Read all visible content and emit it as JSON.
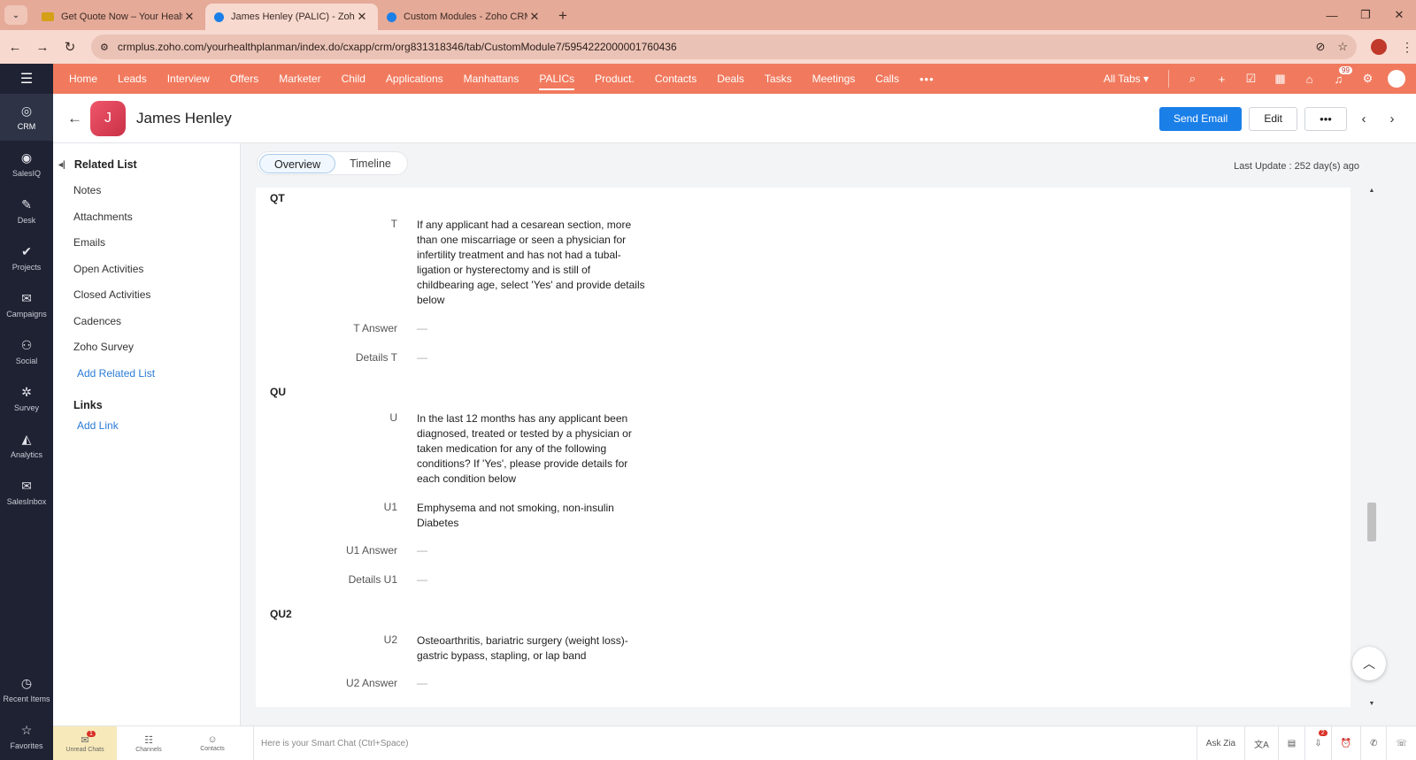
{
  "browser": {
    "tabs": [
      {
        "title": "Get Quote Now – Your Health P",
        "active": false,
        "favicon_color": "#d4a017"
      },
      {
        "title": "James Henley (PALIC) - Zoho CR",
        "active": true,
        "favicon_color": "#1b7fe8"
      },
      {
        "title": "Custom Modules - Zoho CRM",
        "active": false,
        "favicon_color": "#1b7fe8"
      }
    ],
    "new_tab": "+",
    "url": "crmplus.zoho.com/yourhealthplanman/index.do/cxapp/crm/org831318346/tab/CustomModule7/5954222000001760436"
  },
  "rail": {
    "items": [
      {
        "label": "CRM",
        "icon": "crm-icon",
        "glyph": "◎",
        "active": true
      },
      {
        "label": "SalesIQ",
        "icon": "salesiq-icon",
        "glyph": "◉",
        "active": false
      },
      {
        "label": "Desk",
        "icon": "desk-icon",
        "glyph": "✎",
        "active": false
      },
      {
        "label": "Projects",
        "icon": "projects-icon",
        "glyph": "✔",
        "active": false
      },
      {
        "label": "Campaigns",
        "icon": "campaigns-icon",
        "glyph": "✉",
        "active": false
      },
      {
        "label": "Social",
        "icon": "social-icon",
        "glyph": "⚇",
        "active": false
      },
      {
        "label": "Survey",
        "icon": "survey-icon",
        "glyph": "✲",
        "active": false
      },
      {
        "label": "Analytics",
        "icon": "analytics-icon",
        "glyph": "◭",
        "active": false
      },
      {
        "label": "SalesInbox",
        "icon": "salesinbox-icon",
        "glyph": "✉",
        "active": false
      }
    ],
    "bottom": [
      {
        "label": "Recent Items",
        "icon": "clock-icon",
        "glyph": "◷"
      },
      {
        "label": "Favorites",
        "icon": "star-icon",
        "glyph": "☆"
      }
    ]
  },
  "modnav": {
    "items": [
      "Home",
      "Leads",
      "Interview",
      "Offers",
      "Marketer",
      "Child",
      "Applications",
      "Manhattans",
      "PALICs",
      "Product.",
      "Contacts",
      "Deals",
      "Tasks",
      "Meetings",
      "Calls"
    ],
    "active": "PALICs",
    "more": "•••",
    "all_tabs": "All Tabs ▾",
    "notification_count": "99"
  },
  "record": {
    "initial": "J",
    "name": "James Henley",
    "send_email": "Send Email",
    "edit": "Edit",
    "more": "•••"
  },
  "related": {
    "title": "Related List",
    "items": [
      "Notes",
      "Attachments",
      "Emails",
      "Open Activities",
      "Closed Activities",
      "Cadences",
      "Zoho Survey"
    ],
    "add_related": "Add Related List",
    "links_title": "Links",
    "add_link": "Add Link"
  },
  "view": {
    "tabs": [
      "Overview",
      "Timeline"
    ],
    "active_tab": "Overview",
    "last_update": "Last Update : 252 day(s) ago"
  },
  "details": {
    "sections": [
      {
        "title": "QT",
        "fields": [
          {
            "label": "T",
            "value": "If any applicant had a cesarean section, more than one miscarriage or seen a physician for infertility treatment and has not had a tubal-ligation or hysterectomy and is still of childbearing age, select 'Yes' and provide details below"
          },
          {
            "label": "T Answer",
            "value": "—"
          },
          {
            "label": "Details T",
            "value": "—"
          }
        ]
      },
      {
        "title": "QU",
        "fields": [
          {
            "label": "U",
            "value": "In the last 12 months has any applicant been diagnosed, treated or tested by a physician or taken medication for any of the following conditions? If 'Yes', please provide details for each condition below"
          },
          {
            "label": "U1",
            "value": "Emphysema and not smoking, non-insulin Diabetes"
          },
          {
            "label": "U1 Answer",
            "value": "—"
          },
          {
            "label": "Details U1",
            "value": "—"
          }
        ]
      },
      {
        "title": "QU2",
        "fields": [
          {
            "label": "U2",
            "value": "Osteoarthritis, bariatric surgery (weight loss)-gastric bypass, stapling, or lap band"
          },
          {
            "label": "U2 Answer",
            "value": "—"
          }
        ]
      }
    ]
  },
  "bottombar": {
    "items": [
      {
        "label": "Unread Chats",
        "badge": "1"
      },
      {
        "label": "Channels"
      },
      {
        "label": "Contacts"
      }
    ],
    "smart_chat": "Here is your Smart Chat (Ctrl+Space)",
    "ask_zia": "Ask Zia",
    "download_badge": "2"
  }
}
